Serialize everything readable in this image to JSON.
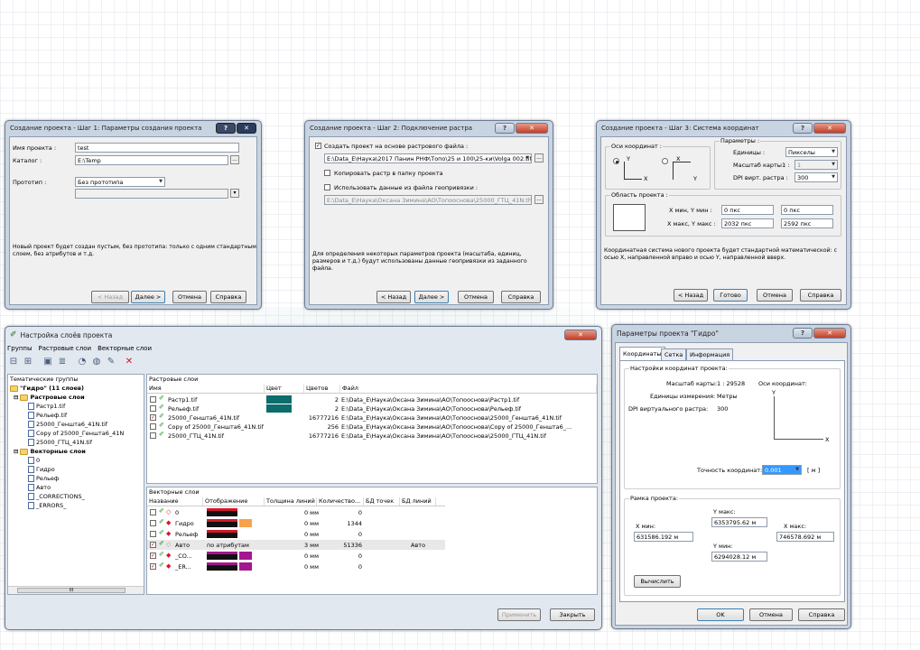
{
  "colors": {
    "teal": "#0d6c6c",
    "black": "#111111",
    "orange": "#f7a24a",
    "purple": "#a4168f",
    "red": "#d4172a",
    "selectionBlue": "#3399ff"
  },
  "w1": {
    "title": "Создание проекта - Шаг 1: Параметры создания проекта",
    "labels": {
      "name": "Имя проекта :",
      "dir": "Каталог :",
      "proto": "Прототип :"
    },
    "values": {
      "name": "test",
      "dir": "E:\\Temp",
      "proto": "Без прототипа"
    },
    "desc": "Новый проект будет создан пустым, без прототипа: только с одним стандартным слоем, без атрибутов и т.д.",
    "buttons": {
      "back": "< Назад",
      "next": "Далее >",
      "cancel": "Отмена",
      "help": "Справка"
    }
  },
  "w2": {
    "title": "Создание проекта - Шаг 2: Подключение растра",
    "opt1": "Создать проект на основе растрового файла :",
    "path1": "E:\\Data_E\\Наука\\2017 Панин РНФ\\Топо\\25 и 100\\25-ки\\Volga 002.tif",
    "opt2": "Копировать растр в папку проекта",
    "opt3": "Использовать данные из файла геопривязки :",
    "path2": "E:\\Data_E\\Наука\\Оксана Зимина\\АО\\Топооснова\\25000_ГТЦ_41N.thx",
    "desc": "Для определения некоторых параметров проекта (масштаба, единиц, размеров и т.д.) будут использованы данные геопривязки из заданного файла.",
    "buttons": {
      "back": "< Назад",
      "next": "Далее >",
      "cancel": "Отмена",
      "help": "Справка"
    }
  },
  "w3": {
    "title": "Создание проекта - Шаг 3: Система координат",
    "axesGroup": "Оси координат :",
    "axisY": "Y",
    "axisX": "X",
    "paramsGroup": "Параметры :",
    "units": "Единицы :",
    "unitsVal": "Пикселы",
    "scale": "Масштаб карты :",
    "scalePrefix": "1 :",
    "scaleVal": "1",
    "dpi": "DPI вирт. растра :",
    "dpiVal": "300",
    "areaGroup": "Область проекта :",
    "xyMin": "X мин, Y мин :",
    "xyMax": "X макс, Y макс :",
    "xMinVal": "0 пкс",
    "yMinVal": "0 пкс",
    "xMaxVal": "2032 пкс",
    "yMaxVal": "2592 пкс",
    "desc": "Координатная система нового проекта будет стандартной математической: с осью X, направленной вправо и осью Y, направленной вверх.",
    "buttons": {
      "back": "< Назад",
      "done": "Готово",
      "cancel": "Отмена",
      "help": "Справка"
    }
  },
  "layers": {
    "title": "Настройка слоёв проекта",
    "menu": [
      "Группы",
      "Растровые слои",
      "Векторные слои"
    ],
    "tree": {
      "header": "Тематические группы",
      "root": "\"Гидро\" (11 слоев)",
      "rasterFolder": "Растровые слои",
      "rasters": [
        "Растр1.tif",
        "Рельеф.tif",
        "25000_Геншта6_41N.tif",
        "Copy of 25000_Геншта6_41N",
        "25000_ГТЦ_41N.tif"
      ],
      "vectorFolder": "Векторные слои",
      "vectors": [
        "0",
        "Гидро",
        "Рельеф",
        "Авто",
        "_CORRECTIONS_",
        "_ERRORS_"
      ],
      "scroll": "III"
    },
    "rasterPanel": {
      "title": "Растровые слои",
      "cols": [
        "Имя",
        "Цвет",
        "Цветов",
        "Файл"
      ],
      "rows": [
        {
          "checked": false,
          "name": "Растр1.tif",
          "colors": "2",
          "file": "E:\\Data_E\\Наука\\Оксана Зимина\\АО\\Топооснова\\Растр1.tif",
          "color": "#0d6c6c"
        },
        {
          "checked": false,
          "name": "Рельеф.tif",
          "colors": "2",
          "file": "E:\\Data_E\\Наука\\Оксана Зимина\\АО\\Топооснова\\Рельеф.tif",
          "color": "#0d6c6c"
        },
        {
          "checked": true,
          "name": "25000_Геншта6_41N.tif",
          "colors": "16777216",
          "file": "E:\\Data_E\\Наука\\Оксана Зимина\\АО\\Топооснова\\25000_Геншта6_41N.tif"
        },
        {
          "checked": false,
          "name": "Copy of 25000_Геншта6_41N.tif",
          "colors": "256",
          "file": "E:\\Data_E\\Наука\\Оксана Зимина\\АО\\Топооснова\\Copy of 25000_Геншта6_..."
        },
        {
          "checked": false,
          "name": "25000_ГТЦ_41N.tif",
          "colors": "16777216",
          "file": "E:\\Data_E\\Наука\\Оксана Зимина\\АО\\Топооснова\\25000_ГТЦ_41N.tif"
        }
      ]
    },
    "vectorPanel": {
      "title": "Векторные слои",
      "cols": [
        "Название",
        "Отображение",
        "Толщина линий",
        "Количество...",
        "БД точек",
        "БД линий"
      ],
      "rows": [
        {
          "checked": false,
          "name": "0",
          "display": "",
          "thick": "0 мм",
          "count": "0",
          "db": "",
          "lineColor": "#d4172a",
          "fillColor": ""
        },
        {
          "checked": false,
          "name": "Гидро",
          "display": "",
          "thick": "0 мм",
          "count": "1344",
          "db": "",
          "lineColor": "#d4172a",
          "fillColor": "#f7a24a"
        },
        {
          "checked": false,
          "name": "Рельеф",
          "display": "",
          "thick": "0 мм",
          "count": "0",
          "db": "",
          "lineColor": "#d4172a",
          "fillColor": ""
        },
        {
          "checked": true,
          "name": "Авто",
          "display": "по атрибутам",
          "thick": "3 мм",
          "count": "51336",
          "db": "Авто",
          "lineColor": "",
          "fillColor": ""
        },
        {
          "checked": true,
          "name": "_CO...",
          "display": "",
          "thick": "0 мм",
          "count": "0",
          "db": "",
          "lineColor": "#a4168f",
          "fillColor": "#a4168f"
        },
        {
          "checked": true,
          "name": "_ER...",
          "display": "",
          "thick": "0 мм",
          "count": "0",
          "db": "",
          "lineColor": "#a4168f",
          "fillColor": "#a4168f"
        }
      ]
    },
    "buttons": {
      "apply": "Применить",
      "close": "Закрыть"
    }
  },
  "params": {
    "title": "Параметры проекта \"Гидро\"",
    "tabs": [
      "Координаты",
      "Сетка",
      "Информация"
    ],
    "coordGroup": "Настройки координат проекта:",
    "scaleLabel": "Масштаб карты:",
    "scaleVal": "1 : 29528",
    "axesLabel": "Оси координат:",
    "unitsLabel": "Единицы измерения:",
    "unitsVal": "Метры",
    "dpiLabel": "DPI виртуального растра:",
    "dpiVal": "300",
    "axisY": "Y",
    "axisX": "X",
    "precLabel": "Точность координат:",
    "precVal": "0.001",
    "precUnit": "[ м ]",
    "frameGroup": "Рамка проекта:",
    "ymaxLabel": "Y макс:",
    "ymaxVal": "6353795.62 м",
    "xminLabel": "X мин:",
    "xminVal": "631586.192 м",
    "xmaxLabel": "X макс:",
    "xmaxVal": "746578.692 м",
    "yminLabel": "Y мин:",
    "yminVal": "6294028.12 м",
    "calc": "Вычислить",
    "buttons": {
      "ok": "OK",
      "cancel": "Отмена",
      "help": "Справка"
    }
  }
}
